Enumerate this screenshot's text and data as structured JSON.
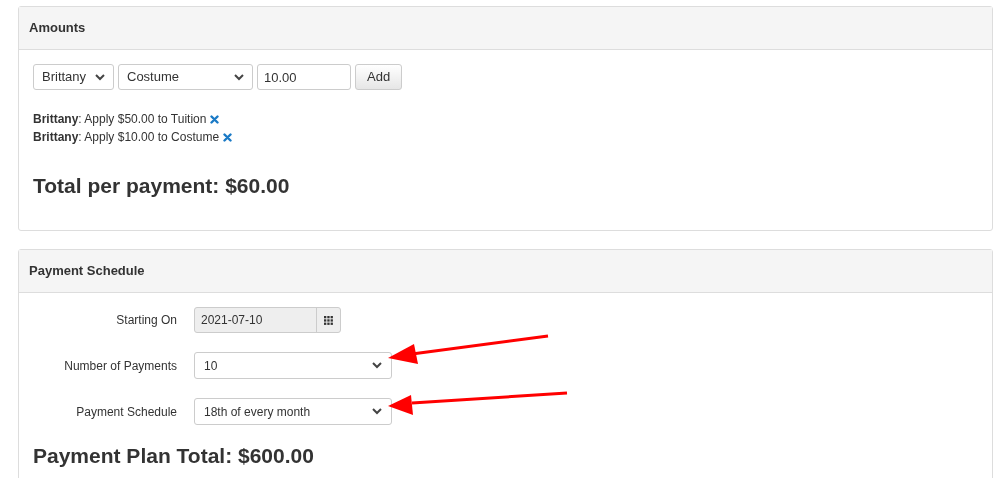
{
  "amounts": {
    "title": "Amounts",
    "student_select": "Brittany",
    "item_select": "Costume",
    "amount_input": "10.00",
    "add_button": "Add",
    "applied": [
      {
        "text": "**Brittany**: Apply $50.00 to Tuition"
      },
      {
        "text": "**Brittany**: Apply $10.00 to Costume"
      }
    ],
    "total": "Total per payment: $60.00"
  },
  "schedule": {
    "title": "Payment Schedule",
    "fields": [
      {
        "kind": "date",
        "label": "Starting On",
        "value": "2021-07-10"
      },
      {
        "kind": "select",
        "label": "Number of Payments",
        "value": "10"
      },
      {
        "kind": "select",
        "label": "Payment Schedule",
        "value": "18th of every month"
      }
    ],
    "total": "Payment Plan Total: $600.00"
  }
}
